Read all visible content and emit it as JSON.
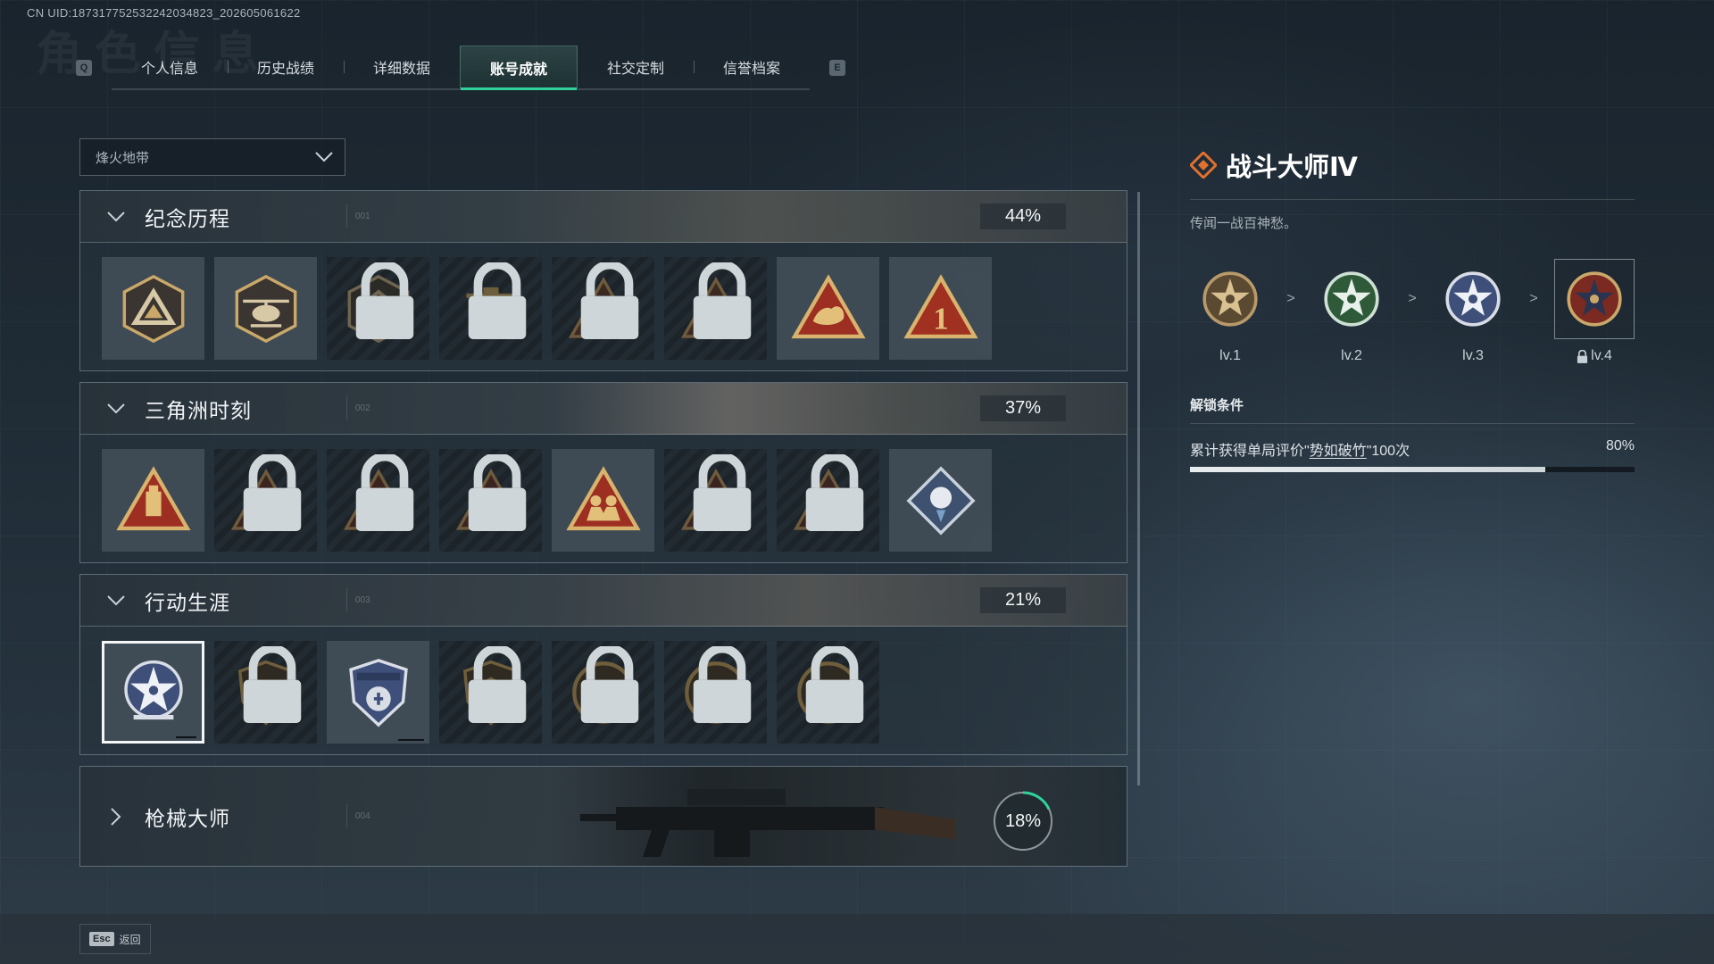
{
  "uid": "CN UID:187317752532242034823_202605061622",
  "tabbar": {
    "left_key": "Q",
    "right_key": "E",
    "tabs": [
      "个人信息",
      "历史战绩",
      "详细数据",
      "账号成就",
      "社交定制",
      "信誉档案"
    ],
    "active": "账号成就"
  },
  "filter": {
    "selected": "烽火地带"
  },
  "sections": [
    {
      "title": "纪念历程",
      "code": "001",
      "percent": "44%",
      "badges": [
        {
          "icon": "triangle-emblem-icon",
          "locked": false
        },
        {
          "icon": "helicopter-emblem-icon",
          "locked": false
        },
        {
          "icon": "shield-emblem-icon",
          "locked": true
        },
        {
          "icon": "turret-emblem-icon",
          "locked": true
        },
        {
          "icon": "hooded-figure-emblem-icon",
          "locked": true
        },
        {
          "icon": "soldier-crossed-emblem-icon",
          "locked": true
        },
        {
          "icon": "hand-emblem-icon",
          "locked": false
        },
        {
          "icon": "number-one-emblem-icon",
          "locked": false
        }
      ]
    },
    {
      "title": "三角洲时刻",
      "code": "002",
      "percent": "37%",
      "badges": [
        {
          "icon": "usb-emblem-icon",
          "locked": false
        },
        {
          "icon": "vault-emblem-icon",
          "locked": true
        },
        {
          "icon": "kneeling-figure-emblem-icon",
          "locked": true
        },
        {
          "icon": "hexagon-emblem-icon",
          "locked": true
        },
        {
          "icon": "squad-emblem-icon",
          "locked": false
        },
        {
          "icon": "rescue-emblem-icon",
          "locked": true
        },
        {
          "icon": "flag-emblem-icon",
          "locked": true
        },
        {
          "icon": "rose-diamond-emblem-icon",
          "locked": false
        }
      ]
    },
    {
      "title": "行动生涯",
      "code": "003",
      "percent": "21%",
      "badges": [
        {
          "icon": "star-medal-icon",
          "locked": false,
          "selected": true
        },
        {
          "icon": "wings-shield-icon",
          "locked": true
        },
        {
          "icon": "police-shield-icon",
          "locked": false
        },
        {
          "icon": "hexagon-shield-icon",
          "locked": true
        },
        {
          "icon": "round-emblem-icon",
          "locked": true
        },
        {
          "icon": "skull-round-icon",
          "locked": true
        },
        {
          "icon": "eye-round-icon",
          "locked": true
        }
      ]
    },
    {
      "title": "枪械大师",
      "code": "004",
      "percent": "18%",
      "progress": 0.18,
      "collapsed": true
    }
  ],
  "detail": {
    "title": "战斗大师Ⅳ",
    "description": "传闻一战百神愁。",
    "levels": [
      {
        "label": "lv.1",
        "color": "#b89a6a",
        "locked": false
      },
      {
        "label": "lv.2",
        "color": "#4f8a5c",
        "locked": false
      },
      {
        "label": "lv.3",
        "color": "#6d7fb3",
        "locked": false
      },
      {
        "label": "lv.4",
        "color": "#9a3a2a",
        "locked": true
      }
    ],
    "separator": ">",
    "unlock_title": "解锁条件",
    "condition_prefix": "累计获得单局评价\"",
    "condition_link": "势如破竹",
    "condition_suffix": "\"100次",
    "condition_percent": "80%",
    "condition_progress": 0.8
  },
  "footer": {
    "esc_key": "Esc",
    "esc_label": "返回"
  },
  "colors": {
    "accent": "#2fd39a",
    "badge_gold": "#c9a86a",
    "badge_red": "#9c2e22"
  }
}
